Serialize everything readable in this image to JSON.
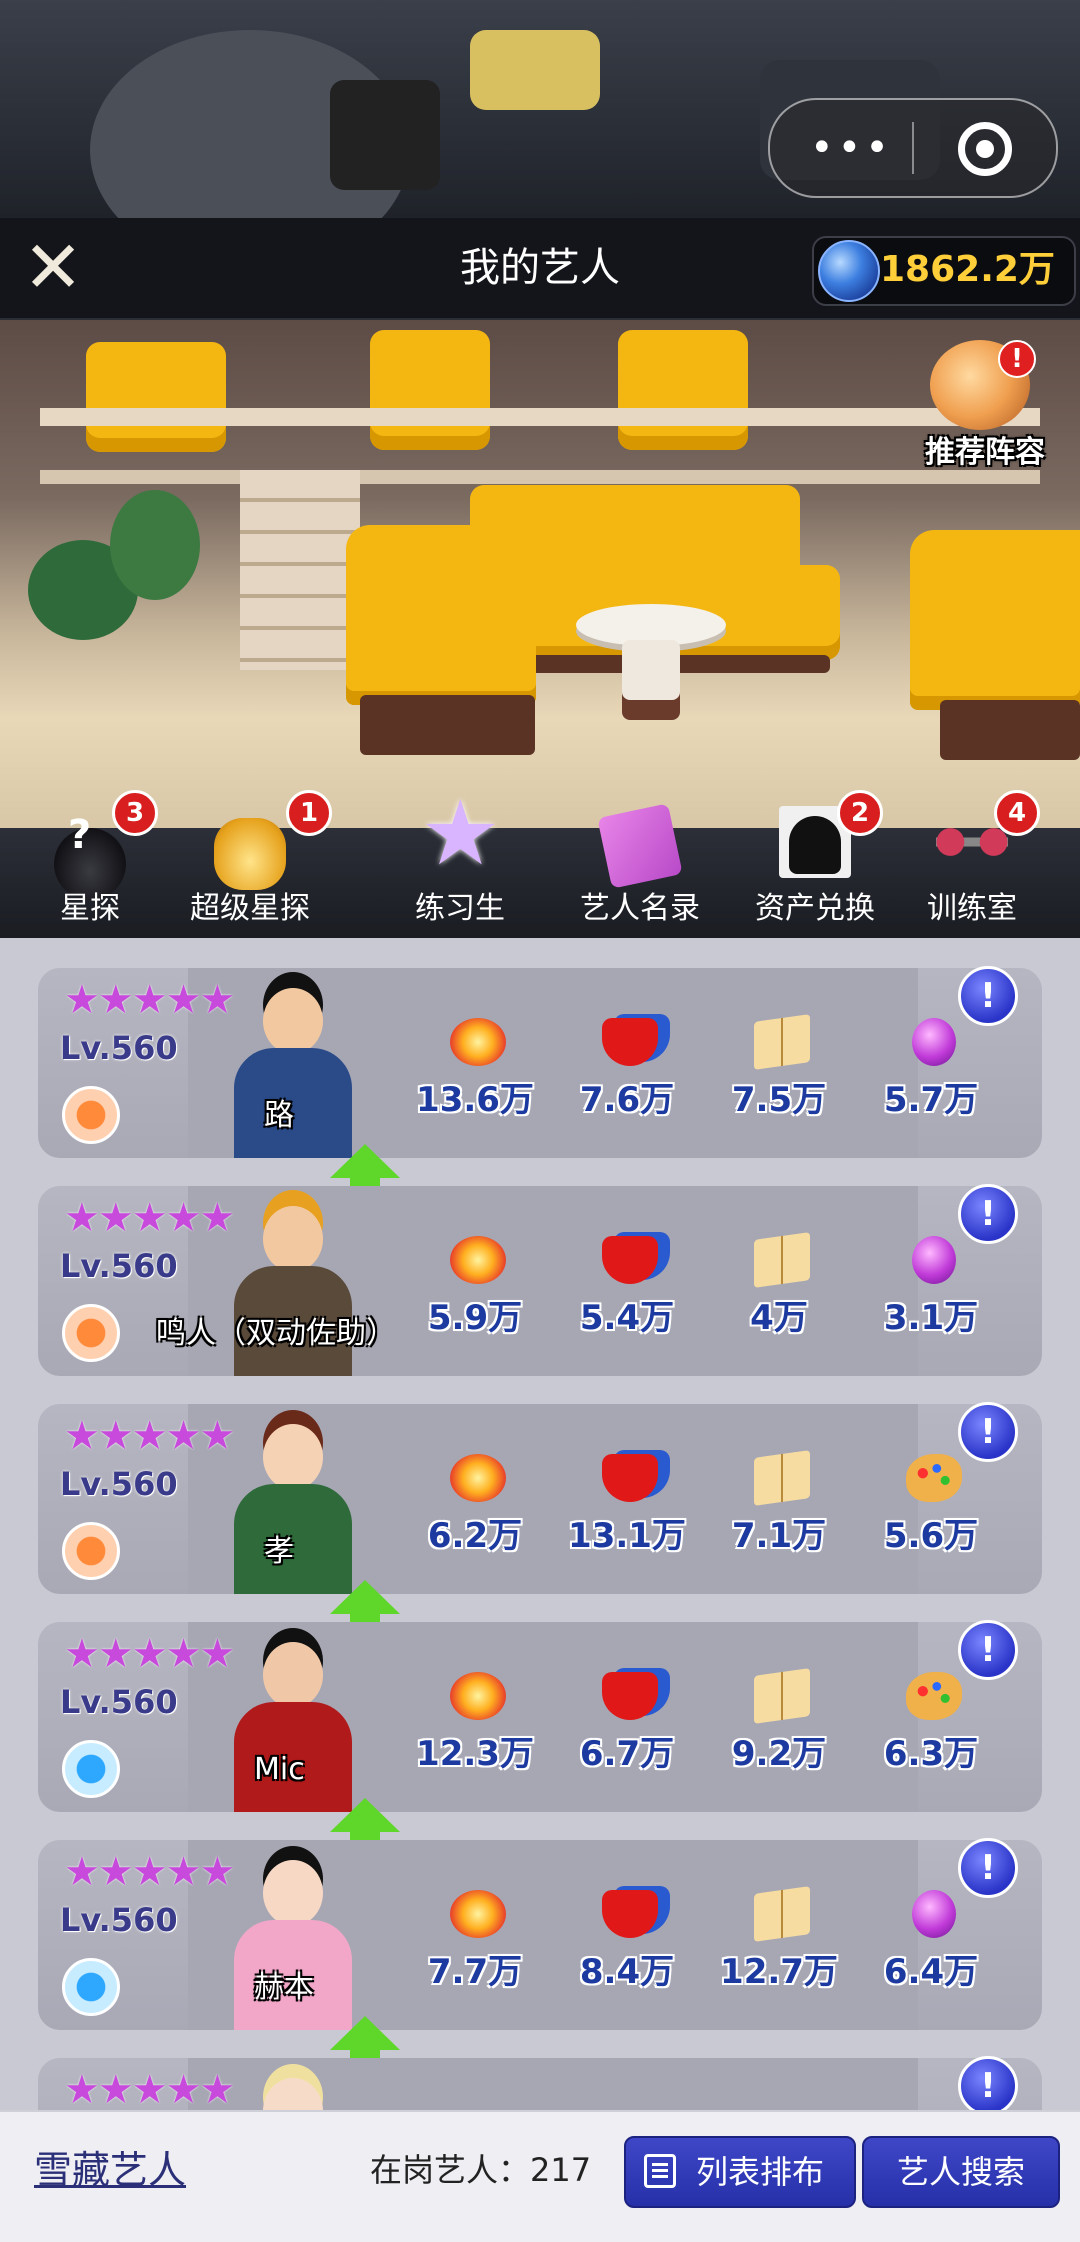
{
  "header": {
    "title": "我的艺人",
    "currency_value": "1862.2万",
    "close_icon": "close-icon"
  },
  "room": {
    "recommend_label": "推荐阵容",
    "recommend_badge": "!"
  },
  "menu": [
    {
      "label": "星探",
      "badge": "3",
      "icon": "scout-hat-icon"
    },
    {
      "label": "超级星探",
      "badge": "1",
      "icon": "super-scout-hat-icon"
    },
    {
      "label": "练习生",
      "badge": "",
      "icon": "star-icon"
    },
    {
      "label": "艺人名录",
      "badge": "",
      "icon": "directory-book-icon"
    },
    {
      "label": "资产兑换",
      "badge": "2",
      "icon": "asset-exchange-icon"
    },
    {
      "label": "训练室",
      "badge": "4",
      "icon": "dumbbell-icon"
    }
  ],
  "artists": [
    {
      "stars": "★★★★★",
      "level": "Lv.560",
      "name": "路",
      "stats": [
        "13.6万",
        "7.6万",
        "7.5万",
        "5.7万"
      ],
      "last_icon": "disco-ball-icon",
      "role": "orange"
    },
    {
      "stars": "★★★★★",
      "level": "Lv.560",
      "name": "鸣人（双动佐助）",
      "stats": [
        "5.9万",
        "5.4万",
        "4万",
        "3.1万"
      ],
      "last_icon": "disco-ball-icon",
      "role": "orange"
    },
    {
      "stars": "★★★★★",
      "level": "Lv.560",
      "name": "孝",
      "stats": [
        "6.2万",
        "13.1万",
        "7.1万",
        "5.6万"
      ],
      "last_icon": "palette-icon",
      "role": "orange"
    },
    {
      "stars": "★★★★★",
      "level": "Lv.560",
      "name": "Mic",
      "stats": [
        "12.3万",
        "6.7万",
        "9.2万",
        "6.3万"
      ],
      "last_icon": "palette-icon",
      "role": "blue"
    },
    {
      "stars": "★★★★★",
      "level": "Lv.560",
      "name": "赫本",
      "stats": [
        "7.7万",
        "8.4万",
        "12.7万",
        "6.4万"
      ],
      "last_icon": "disco-ball-icon",
      "role": "blue"
    },
    {
      "stars": "★★★★★",
      "level": "",
      "name": "",
      "stats": [
        "",
        "",
        "",
        ""
      ],
      "last_icon": "disco-ball-icon",
      "role": "orange"
    }
  ],
  "info_label": "!",
  "bottom": {
    "snow_label": "雪藏艺人",
    "staff_label": "在岗艺人：217",
    "list_sort_label": "列表排布",
    "search_label": "艺人搜索"
  },
  "colors": {
    "accent": "#2a34c8",
    "currency": "#ffcf3a",
    "star": "#c84adc",
    "stat_text": "#1c3aa0",
    "badge": "#d81e1e",
    "up_arrow": "#5fd62a"
  }
}
